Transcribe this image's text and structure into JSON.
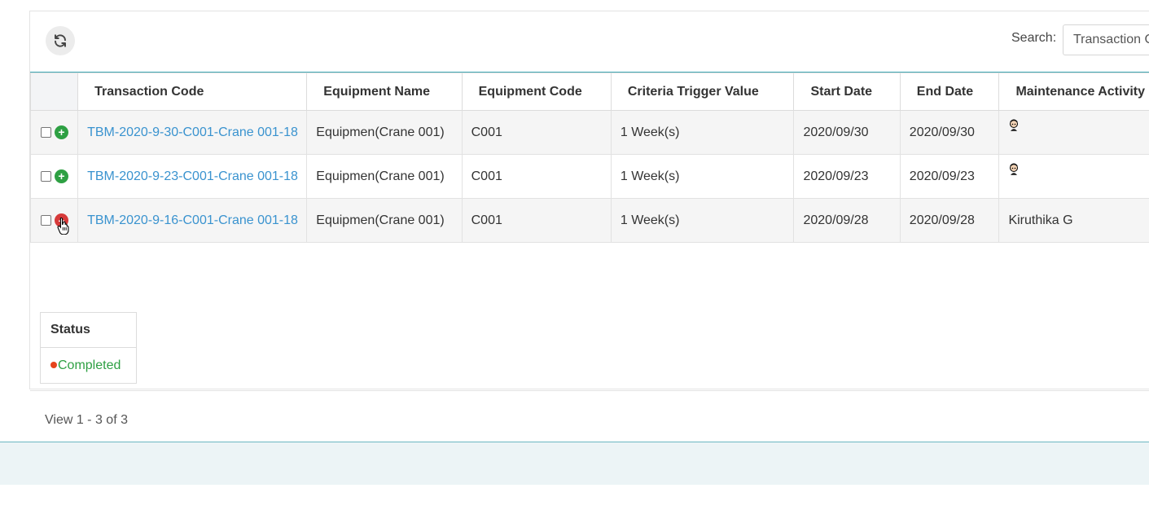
{
  "toolbar": {
    "refresh_icon": "refresh-icon",
    "search_label": "Search:",
    "search_value": "Transaction Code"
  },
  "grid": {
    "columns": [
      "Transaction Code",
      "Equipment Name",
      "Equipment Code",
      "Criteria Trigger Value",
      "Start Date",
      "End Date",
      "Maintenance Activity"
    ],
    "rows": [
      {
        "expander": "+",
        "expander_color": "#2ea043",
        "transaction_code": "TBM-2020-9-30-C001-Crane 001-18",
        "equipment_name": "Equipmen(Crane 001)",
        "equipment_code": "C001",
        "criteria_trigger": "1 Week(s)",
        "start_date": "2020/09/30",
        "end_date": "2020/09/30",
        "maintenance_activity": "",
        "maintenance_icon": "user-avatar-icon"
      },
      {
        "expander": "+",
        "expander_color": "#2ea043",
        "transaction_code": "TBM-2020-9-23-C001-Crane 001-18",
        "equipment_name": "Equipmen(Crane 001)",
        "equipment_code": "C001",
        "criteria_trigger": "1 Week(s)",
        "start_date": "2020/09/23",
        "end_date": "2020/09/23",
        "maintenance_activity": "",
        "maintenance_icon": "user-avatar-icon"
      },
      {
        "expander": "–",
        "expander_color": "#d63a3a",
        "transaction_code": "TBM-2020-9-16-C001-Crane 001-18",
        "equipment_name": "Equipmen(Crane 001)",
        "equipment_code": "C001",
        "criteria_trigger": "1 Week(s)",
        "start_date": "2020/09/28",
        "end_date": "2020/09/28",
        "maintenance_activity": "Kiruthika G",
        "maintenance_icon": ""
      }
    ]
  },
  "subgrid": {
    "header": "Status",
    "status_text": "Completed",
    "status_dot_color": "#e6441c",
    "status_text_color": "#2ea043"
  },
  "pager": {
    "info": "View 1 - 3 of 3"
  }
}
